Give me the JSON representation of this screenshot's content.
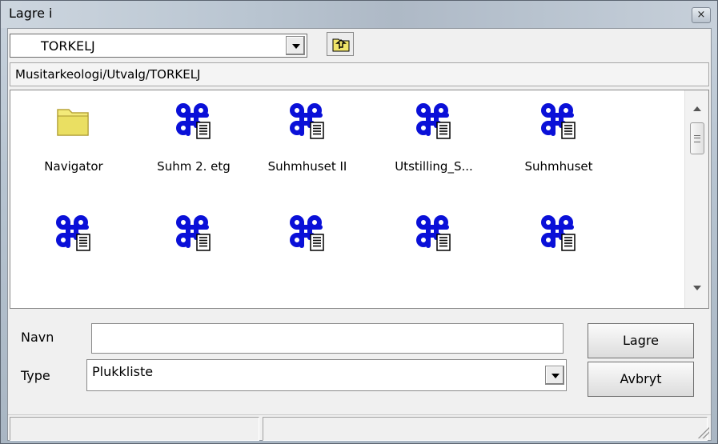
{
  "window": {
    "title": "Lagre i",
    "close_glyph": "×"
  },
  "toolbar": {
    "folder_combo": {
      "value": "TORKELJ",
      "icon": "dropdown-arrow"
    },
    "up_button": {
      "icon": "folder-up-icon"
    }
  },
  "path_bar": {
    "text": "Musitarkeologi/Utvalg/TORKELJ"
  },
  "files": {
    "items": [
      {
        "label": "Navigator",
        "icon": "folder-icon"
      },
      {
        "label": "Suhm 2. etg",
        "icon": "command-doc-icon"
      },
      {
        "label": "Suhmhuset II",
        "icon": "command-doc-icon"
      },
      {
        "label": "Utstilling_S...",
        "icon": "command-doc-icon"
      },
      {
        "label": "Suhmhuset",
        "icon": "command-doc-icon"
      },
      {
        "label": "",
        "icon": "command-doc-icon"
      },
      {
        "label": "",
        "icon": "command-doc-icon"
      },
      {
        "label": "",
        "icon": "command-doc-icon"
      },
      {
        "label": "",
        "icon": "command-doc-icon"
      },
      {
        "label": "",
        "icon": "command-doc-icon"
      }
    ]
  },
  "form": {
    "name_label": "Navn",
    "name_value": "",
    "type_label": "Type",
    "type_value": "Plukkliste"
  },
  "buttons": {
    "save_label": "Lagre",
    "cancel_label": "Avbryt"
  },
  "status_bar": {
    "left": "",
    "right": ""
  },
  "colors": {
    "icon_blue": "#0a10d8",
    "folder_yellow": "#f3ea79",
    "accent_border": "#6d6d6d"
  }
}
